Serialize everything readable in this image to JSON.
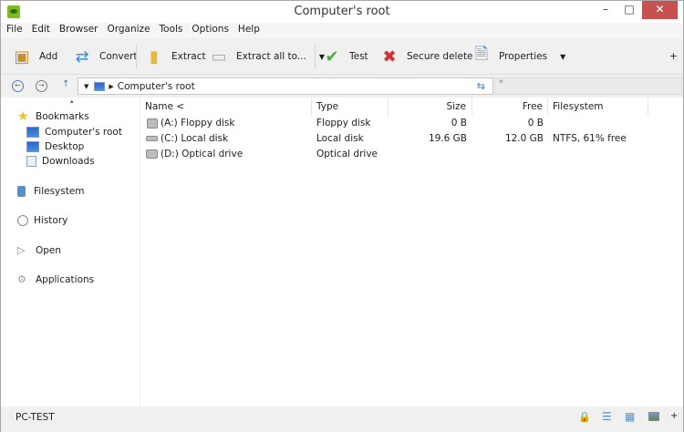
{
  "window": {
    "title": "Computer's root",
    "minimize": "–",
    "maximize": "□",
    "close": "✕"
  },
  "menu": [
    "File",
    "Edit",
    "Browser",
    "Organize",
    "Tools",
    "Options",
    "Help"
  ],
  "toolbar": {
    "add": "Add",
    "convert": "Convert",
    "extract": "Extract",
    "extract_all": "Extract all to...",
    "test": "Test",
    "secure_delete": "Secure delete",
    "properties": "Properties",
    "more": "+"
  },
  "address": {
    "path": "Computer's root",
    "filter": "*"
  },
  "sidebar": {
    "up": "▴",
    "bookmarks": "Bookmarks",
    "items": [
      "Computer's root",
      "Desktop",
      "Downloads"
    ],
    "filesystem": "Filesystem",
    "history": "History",
    "open": "Open",
    "applications": "Applications"
  },
  "list": {
    "columns": [
      "Name <",
      "Type",
      "Size",
      "Free",
      "Filesystem"
    ],
    "rows": [
      {
        "name": "(A:) Floppy disk",
        "type": "Floppy disk",
        "size": "0 B",
        "free": "0 B",
        "fs": ""
      },
      {
        "name": "(C:) Local disk",
        "type": "Local disk",
        "size": "19.6 GB",
        "free": "12.0 GB",
        "fs": "NTFS, 61% free"
      },
      {
        "name": "(D:) Optical drive",
        "type": "Optical drive",
        "size": "",
        "free": "",
        "fs": ""
      }
    ]
  },
  "status": {
    "text": "PC-TEST",
    "more": "+"
  }
}
